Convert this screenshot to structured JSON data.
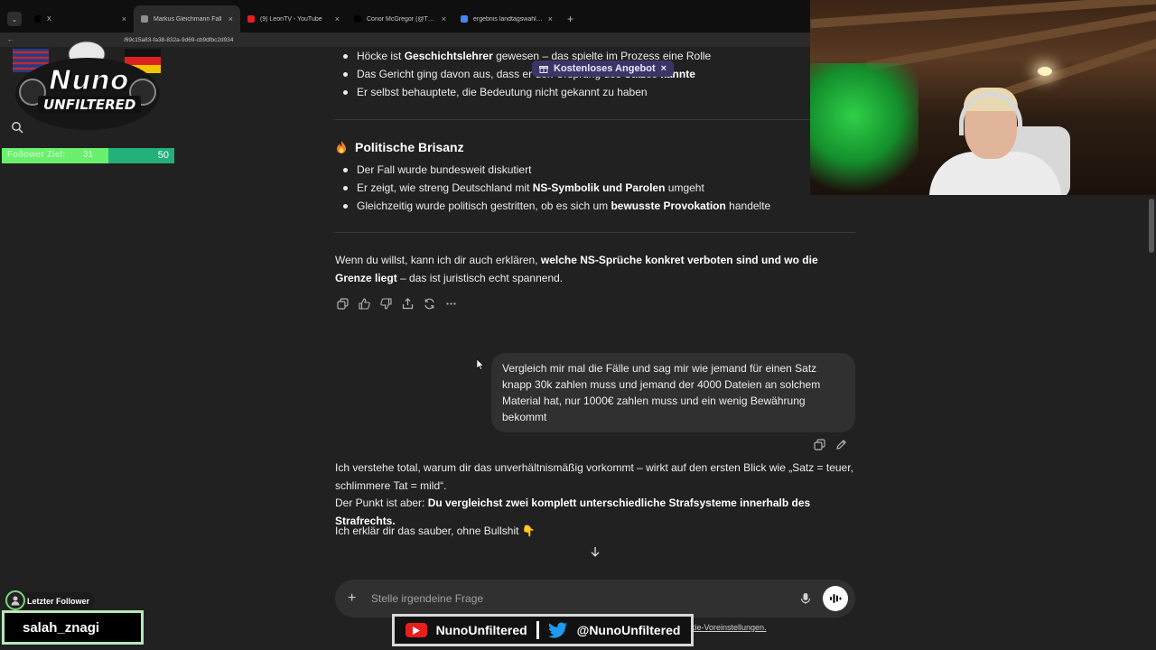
{
  "browser": {
    "tabs": [
      {
        "title": "X",
        "active": false,
        "favicon_color": "#000000"
      },
      {
        "title": "Markus Gleichmann Fall",
        "active": true,
        "favicon_color": "#8e8e8e"
      },
      {
        "title": "(9) LeonTV - YouTube",
        "active": false,
        "favicon_color": "#e61e1e"
      },
      {
        "title": "Conor McGregor (@TheNotori",
        "active": false,
        "favicon_color": "#000000"
      },
      {
        "title": "ergebnis landtagswahl rheinlan",
        "active": false,
        "favicon_color": "#4285f4"
      }
    ],
    "new_tab": "+",
    "url": "/69c15a83-fa38-832a-9d69-cb9dfbc2d934"
  },
  "promo": {
    "label": "Kostenloses Angebot",
    "close": "×"
  },
  "conversation": {
    "top_bullets": [
      [
        {
          "t": "Höcke ist "
        },
        {
          "t": "Geschichtslehrer",
          "b": true
        },
        {
          "t": " gewesen – das spielte im Prozess eine Rolle"
        }
      ],
      [
        {
          "t": "Das Gericht ging davon aus, dass er den Ursprung des Satzes "
        },
        {
          "t": "kannte",
          "b": true
        }
      ],
      [
        {
          "t": "Er selbst behauptete, die Bedeutung nicht gekannt zu haben"
        }
      ]
    ],
    "section_heading": {
      "icon": "fire-icon",
      "text": "Politische Brisanz"
    },
    "section_bullets": [
      [
        {
          "t": "Der Fall wurde bundesweit diskutiert"
        }
      ],
      [
        {
          "t": "Er zeigt, wie streng Deutschland mit "
        },
        {
          "t": "NS-Symbolik und Parolen",
          "b": true
        },
        {
          "t": " umgeht"
        }
      ],
      [
        {
          "t": "Gleichzeitig wurde politisch gestritten, ob es sich um "
        },
        {
          "t": "bewusste Provokation",
          "b": true
        },
        {
          "t": " handelte"
        }
      ]
    ],
    "followup": [
      {
        "t": "Wenn du willst, kann ich dir auch erklären, "
      },
      {
        "t": "welche NS-Sprüche konkret verboten sind und wo die Grenze liegt",
        "b": true
      },
      {
        "t": " – das ist juristisch echt spannend."
      }
    ],
    "user_message": "Vergleich mir mal die Fälle und sag mir wie jemand für einen Satz knapp 30k zahlen muss und jemand der 4000 Dateien an solchem Material hat, nur 1000€ zahlen muss und ein wenig Bewährung bekommt",
    "answer_p1": "Ich verstehe total, warum dir das unverhältnismäßig vorkommt – wirkt auf den ersten Blick wie „Satz = teuer, schlimmere Tat = mild“.",
    "answer_p2": [
      {
        "t": "Der Punkt ist aber: "
      },
      {
        "t": "Du vergleichst zwei komplett unterschiedliche Strafsysteme innerhalb des Strafrechts.",
        "b": true
      }
    ],
    "answer_p3": "Ich erklär dir das sauber, ohne Bullshit 👇"
  },
  "composer": {
    "placeholder": "Stelle irgendeine Frage"
  },
  "footer_note": "kie-Voreinstellungen.",
  "overlay": {
    "logo_top": "Nuno",
    "logo_bottom": "UNFILTERED",
    "follower_goal": {
      "label": "Follower Ziel:",
      "current": "31",
      "target": "50",
      "progress": 0.62
    },
    "last_follower_label": "Letzter Follower",
    "last_follower_name": "salah_znagi",
    "youtube_handle": "NunoUnfiltered",
    "twitter_handle": "@NunoUnfiltered"
  }
}
